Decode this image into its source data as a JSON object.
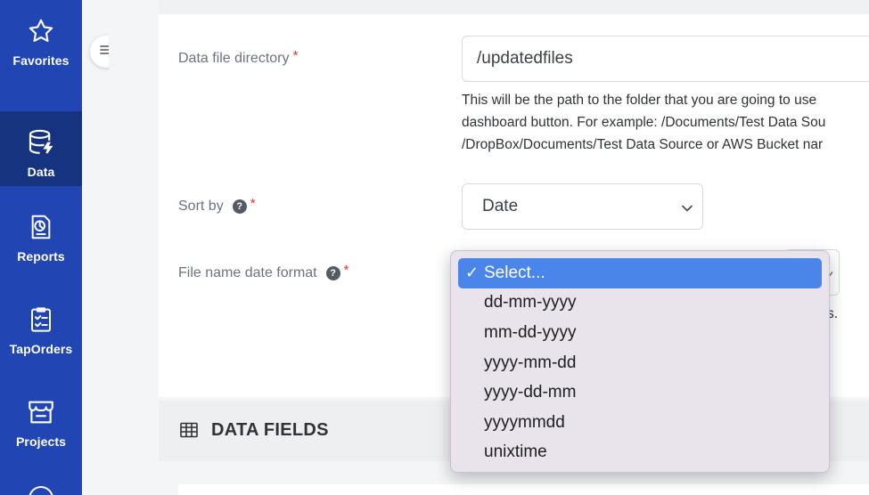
{
  "sidebar": {
    "items": [
      {
        "label": "Favorites",
        "icon": "star-icon",
        "active": false
      },
      {
        "label": "Data",
        "icon": "database-icon",
        "active": true
      },
      {
        "label": "Reports",
        "icon": "report-icon",
        "active": false
      },
      {
        "label": "TapOrders",
        "icon": "checklist-icon",
        "active": false
      },
      {
        "label": "Projects",
        "icon": "store-icon",
        "active": false
      }
    ]
  },
  "form": {
    "data_file_directory": {
      "label": "Data file directory",
      "required": "*",
      "value": "/updatedfiles",
      "hint_lines": [
        "This will be the path to the folder that you are going to use",
        "dashboard button. For example: /Documents/Test Data Sou",
        "/DropBox/Documents/Test Data Source or AWS Bucket nar"
      ]
    },
    "sort_by": {
      "label": "Sort by",
      "help": "?",
      "required": "*",
      "value": "Date"
    },
    "file_name_date_format": {
      "label": "File name date format",
      "help": "?",
      "required": "*",
      "trailing_text": "s."
    }
  },
  "dropdown": {
    "check": "✓",
    "options": [
      "Select...",
      "dd-mm-yyyy",
      "mm-dd-yyyy",
      "yyyy-mm-dd",
      "yyyy-dd-mm",
      "yyyymmdd",
      "unixtime"
    ],
    "selected_index": 0
  },
  "section": {
    "title": "DATA FIELDS"
  },
  "colors": {
    "sidebar": "#2146b3",
    "sidebar_active": "#16337f",
    "selected_option": "#4a86ea",
    "required": "#e53935"
  }
}
